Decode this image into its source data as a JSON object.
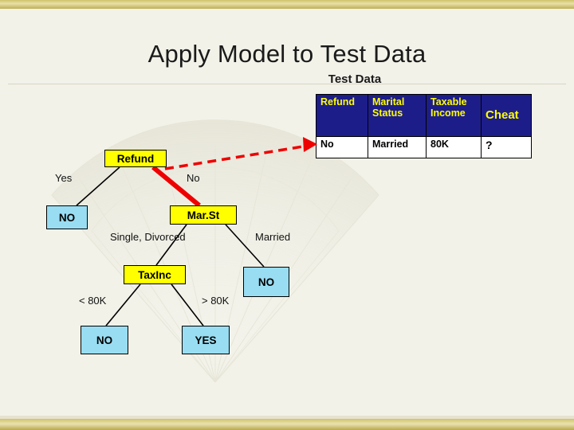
{
  "slide": {
    "title": "Apply Model to Test Data",
    "subtitle": "Test Data"
  },
  "table": {
    "headers": [
      "Refund",
      "Marital Status",
      "Taxable Income",
      "Cheat"
    ],
    "header_parts": {
      "refund": "Refund",
      "marital_line1": "Marital",
      "marital_line2": "Status",
      "taxable_line1": "Taxable",
      "taxable_line2": "Income",
      "cheat": "Cheat"
    },
    "rows": [
      {
        "refund": "No",
        "marital": "Married",
        "taxable": "80K",
        "cheat": "?"
      }
    ]
  },
  "tree": {
    "nodes": [
      {
        "id": "refund",
        "label": "Refund",
        "style": "yellow"
      },
      {
        "id": "no-left",
        "label": "NO",
        "style": "blue"
      },
      {
        "id": "marst",
        "label": "Mar.St",
        "style": "yellow"
      },
      {
        "id": "taxinc",
        "label": "TaxInc",
        "style": "yellow"
      },
      {
        "id": "no-right",
        "label": "NO",
        "style": "blue"
      },
      {
        "id": "no-leaf",
        "label": "NO",
        "style": "blue"
      },
      {
        "id": "yes-leaf",
        "label": "YES",
        "style": "blue"
      }
    ],
    "edge_labels": {
      "yes": "Yes",
      "no": "No",
      "single_divorced": "Single, Divorced",
      "married": "Married",
      "lt_80k": "< 80K",
      "gt_80k": "> 80K"
    }
  },
  "colors": {
    "background": "#f2f2e9",
    "gold_bar": "#cfc36a",
    "node_yellow": "#ffff00",
    "node_blue": "#99ddf2",
    "header_blue": "#1d1d8a",
    "header_text": "#ffff00",
    "highlight_red": "#ee0000"
  }
}
